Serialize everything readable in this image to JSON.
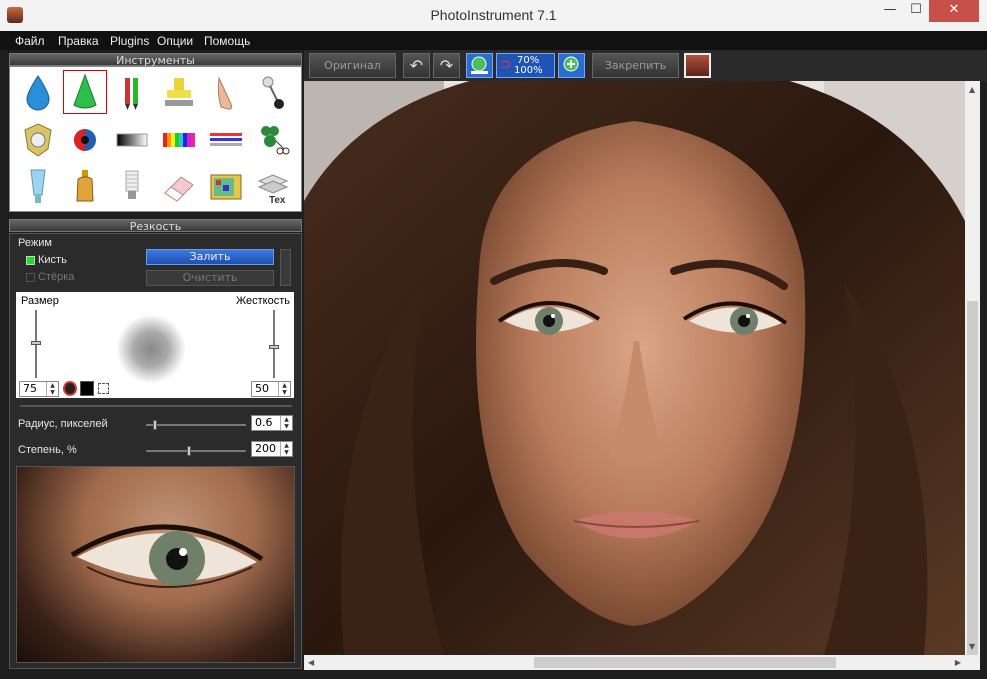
{
  "window": {
    "title": "PhotoInstrument 7.1",
    "min": "—",
    "max": "☐",
    "close": "✕"
  },
  "menu": [
    "Файл",
    "Правка",
    "Plugins",
    "Опции",
    "Помощь"
  ],
  "tools_panel": {
    "title": "Инструменты"
  },
  "tools": [
    {
      "name": "drop-icon",
      "glyph": "💧"
    },
    {
      "name": "sharpen-cone-icon",
      "glyph": "▲"
    },
    {
      "name": "pencil-icon",
      "glyph": "✎"
    },
    {
      "name": "stamp-icon",
      "glyph": "■"
    },
    {
      "name": "finger-icon",
      "glyph": "☝"
    },
    {
      "name": "pin-icon",
      "glyph": "⚲"
    },
    {
      "name": "shield-icon",
      "glyph": "⛉"
    },
    {
      "name": "eye-color-icon",
      "glyph": "◐"
    },
    {
      "name": "gradient-icon",
      "glyph": "▬"
    },
    {
      "name": "color-bars-icon",
      "glyph": "▦"
    },
    {
      "name": "lines-icon",
      "glyph": "≡"
    },
    {
      "name": "clone-scissors-icon",
      "glyph": "✂"
    },
    {
      "name": "tube-icon",
      "glyph": "▼"
    },
    {
      "name": "bottle-icon",
      "glyph": "⚱"
    },
    {
      "name": "bulb-icon",
      "glyph": "☀"
    },
    {
      "name": "eraser-icon",
      "glyph": "▰"
    },
    {
      "name": "tv-icon",
      "glyph": "▣"
    },
    {
      "name": "text-layers-icon",
      "glyph": "Tex"
    }
  ],
  "settings": {
    "title": "Резкость",
    "mode_label": "Режим",
    "brush_label": "Кисть",
    "eraser_label": "Стёрка",
    "fill_button": "Залить",
    "clear_button": "Очистить",
    "size_label": "Размер",
    "hardness_label": "Жесткость",
    "size_value": "75",
    "hardness_value": "50",
    "radius_label": "Радиус, пикселей",
    "radius_value": "0.6",
    "degree_label": "Степень, %",
    "degree_value": "200"
  },
  "toolbar": {
    "original": "Оригинал",
    "pin": "Закрепить",
    "zoom_top": "70%",
    "zoom_bottom": "100%"
  },
  "colors": {
    "accent": "#1d4fb0",
    "close": "#c7504b",
    "selected_tool": "#dd0000"
  }
}
